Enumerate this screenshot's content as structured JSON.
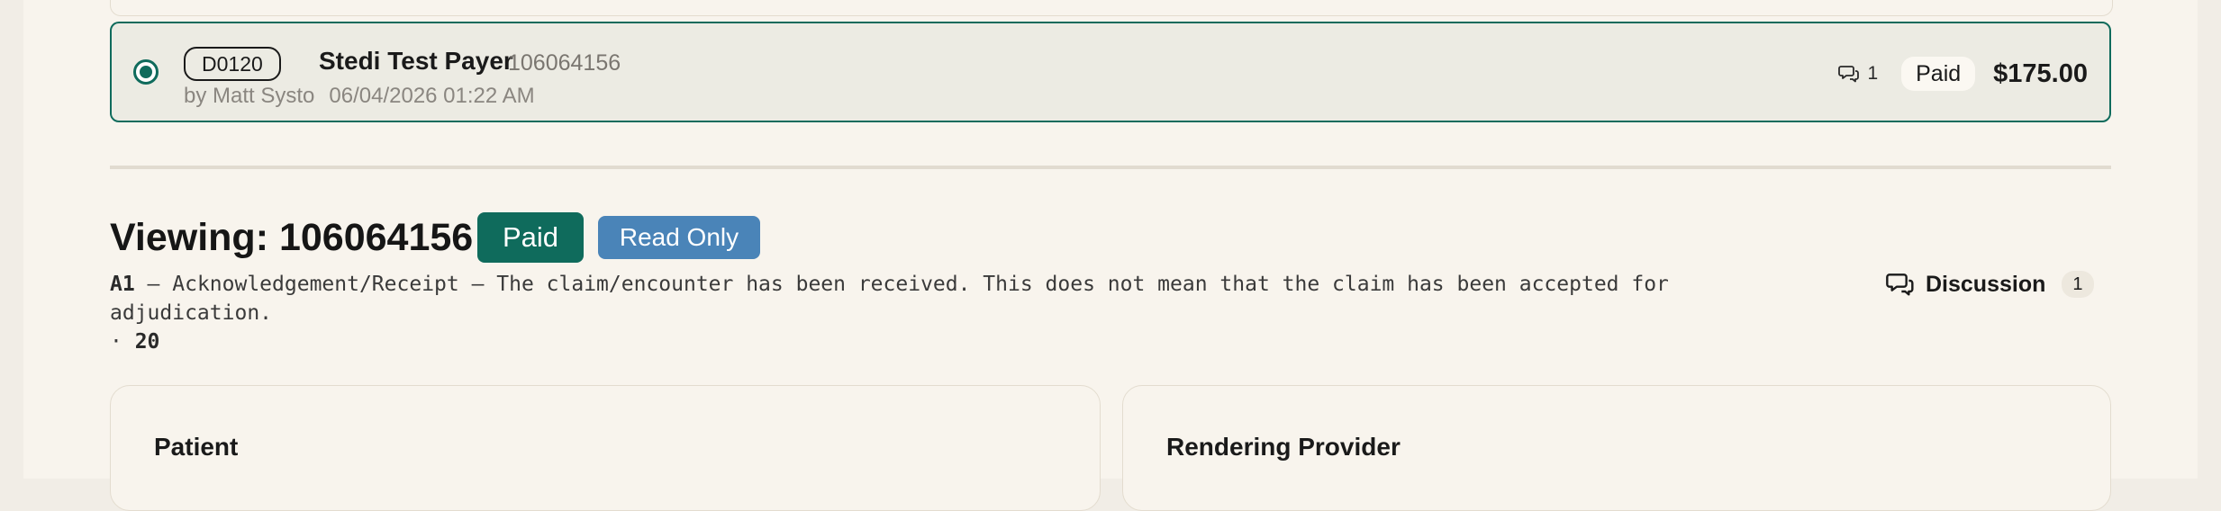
{
  "claim_row": {
    "code": "D0120",
    "payer_name": "Stedi Test Payer",
    "payer_id": "106064156",
    "author": "by Matt Systo",
    "timestamp": "06/04/2026 01:22 AM",
    "comment_count": "1",
    "status": "Paid",
    "amount": "$175.00"
  },
  "viewing": {
    "title": "Viewing: 106064156",
    "status_badge": "Paid",
    "mode_badge": "Read Only",
    "ack_code": "A1",
    "ack_text": " — Acknowledgement/Receipt — The claim/encounter has been received. This does not mean that the claim has been accepted for adjudication.",
    "ack_prefix": "· ",
    "ack_value": "20"
  },
  "discussion": {
    "label": "Discussion",
    "count": "1"
  },
  "panels": {
    "left_title": "Patient",
    "right_title": "Rendering Provider"
  },
  "colors": {
    "accent": "#0f6b5c",
    "read_only": "#4a84b8",
    "background": "#f8f4ed"
  },
  "icons": {
    "comment": "speech-bubbles-icon",
    "radio": "radio-selected-icon"
  }
}
